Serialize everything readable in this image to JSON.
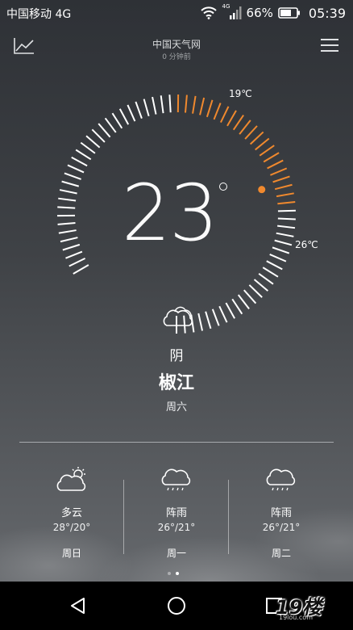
{
  "status_bar": {
    "carrier": "中国移动 4G",
    "network_badge": "4G",
    "battery": "66%",
    "time": "05:39"
  },
  "app_bar": {
    "title": "中国天气网",
    "updated": "0 分钟前",
    "left_icon": "trend-chart-icon",
    "right_icon": "menu-icon"
  },
  "dial": {
    "temperature": "23",
    "low_label": "19℃",
    "high_label": "26℃",
    "accent_color": "#f0892e"
  },
  "current": {
    "icon": "cloud-icon",
    "condition": "阴",
    "city": "椒江",
    "day": "周六"
  },
  "forecast": [
    {
      "icon": "partly-cloudy-icon",
      "condition": "多云",
      "range": "28°/20°",
      "day": "周日"
    },
    {
      "icon": "rain-icon",
      "condition": "阵雨",
      "range": "26°/21°",
      "day": "周一"
    },
    {
      "icon": "rain-icon",
      "condition": "阵雨",
      "range": "26°/21°",
      "day": "周二"
    }
  ],
  "watermark": {
    "logo": "19楼",
    "url": "19lou.com"
  }
}
